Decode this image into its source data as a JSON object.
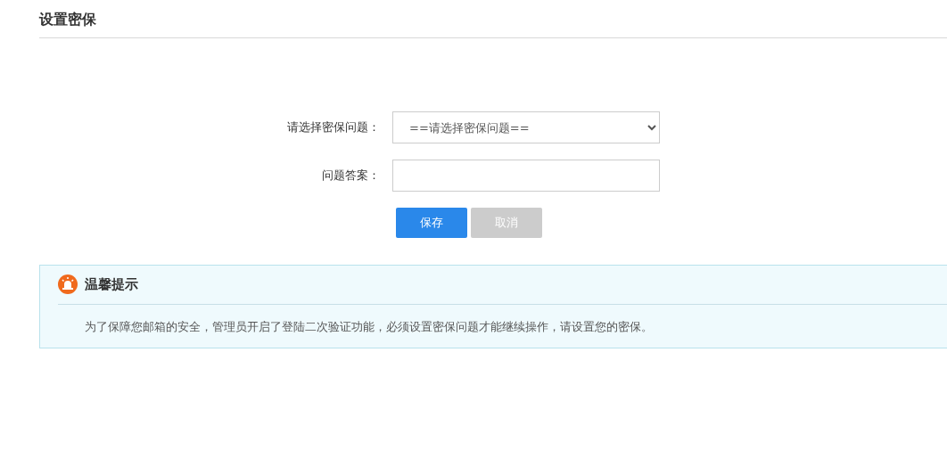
{
  "title": "设置密保",
  "form": {
    "fields": [
      {
        "kind": "select",
        "label": "请选择密保问题：",
        "value": "==请选择密保问题=="
      },
      {
        "kind": "text",
        "label": "问题答案："
      }
    ],
    "buttons": [
      {
        "label": "保存",
        "kind": "primary"
      },
      {
        "label": "取消",
        "kind": "muted"
      }
    ]
  },
  "notice": {
    "title": "温馨提示",
    "text": "为了保障您邮箱的安全，管理员开启了登陆二次验证功能，必须设置密保问题才能继续操作，请设置您的密保。"
  }
}
